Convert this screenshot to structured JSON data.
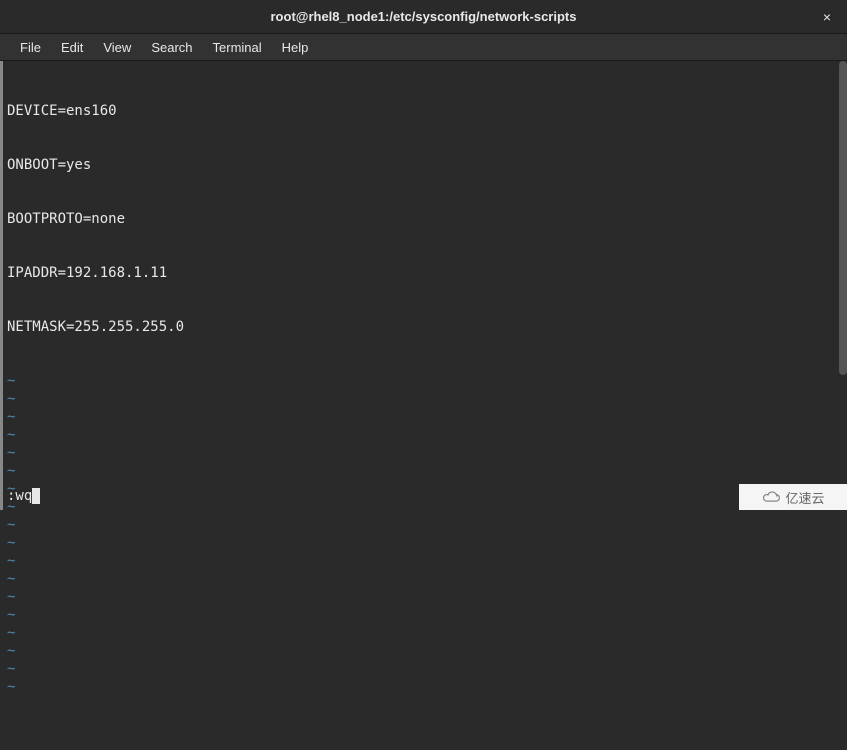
{
  "titlebar": {
    "title": "root@rhel8_node1:/etc/sysconfig/network-scripts",
    "close": "×"
  },
  "menubar": {
    "items": [
      "File",
      "Edit",
      "View",
      "Search",
      "Terminal",
      "Help"
    ]
  },
  "terminal": {
    "lines": [
      "DEVICE=ens160",
      "ONBOOT=yes",
      "BOOTPROTO=none",
      "IPADDR=192.168.1.11",
      "NETMASK=255.255.255.0"
    ],
    "tilde_count": 18,
    "command": ":wq"
  },
  "watermark": {
    "text": "亿速云"
  }
}
